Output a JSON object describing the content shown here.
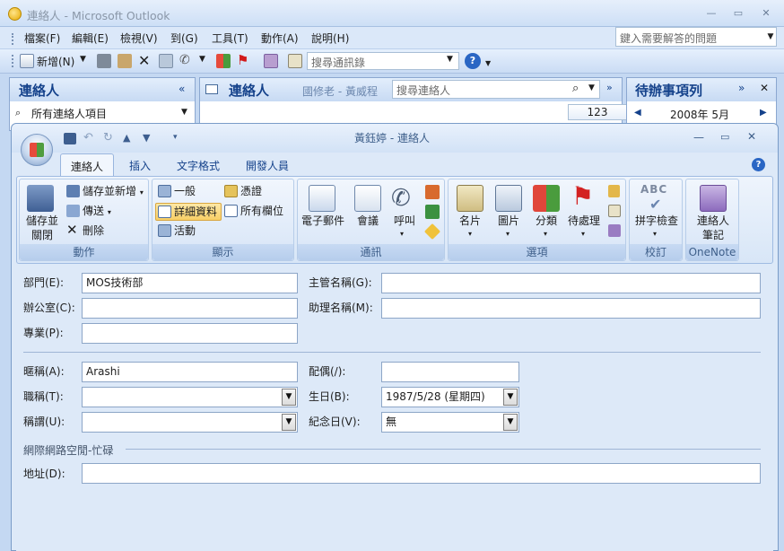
{
  "window": {
    "title": "連絡人 - Microsoft Outlook"
  },
  "menu": [
    "檔案(F)",
    "編輯(E)",
    "檢視(V)",
    "到(G)",
    "工具(T)",
    "動作(A)",
    "說明(H)"
  ],
  "help_box": {
    "placeholder": "鍵入需要解答的問題"
  },
  "toolbar": {
    "new_label": "新增(N)",
    "search_placeholder": "搜尋通訊錄"
  },
  "left_pane": {
    "title": "連絡人",
    "item": "所有連絡人項目"
  },
  "mid_pane": {
    "title": "連絡人",
    "subtitle": "國修老 - 黃威程",
    "search_placeholder": "搜尋連絡人",
    "index_button": "123"
  },
  "right_pane": {
    "title": "待辦事項列",
    "month": "2008年 5月"
  },
  "inspector": {
    "title": "黃鈺婷 - 連絡人",
    "tabs": [
      "連絡人",
      "插入",
      "文字格式",
      "開發人員"
    ],
    "groups": {
      "actions": {
        "label": "動作",
        "save_close": "儲存並\n關閉",
        "save_new": "儲存並新增",
        "send": "傳送",
        "delete": "刪除"
      },
      "show": {
        "label": "顯示",
        "general": "一般",
        "certificates": "憑證",
        "details": "詳細資料",
        "all_fields": "所有欄位",
        "activities": "活動"
      },
      "communicate": {
        "label": "通訊",
        "email": "電子郵件",
        "meeting": "會議",
        "call": "呼叫"
      },
      "options": {
        "label": "選項",
        "business_card": "名片",
        "picture": "圖片",
        "categorize": "分類",
        "follow_up": "待處理"
      },
      "proofing": {
        "label": "校訂",
        "spelling": "拼字檢查"
      },
      "onenote": {
        "label": "OneNote",
        "contact_notes": "連絡人\n筆記"
      }
    }
  },
  "form": {
    "department": {
      "label": "部門(E):",
      "value": "MOS技術部"
    },
    "office": {
      "label": "辦公室(C):",
      "value": ""
    },
    "profession": {
      "label": "專業(P):",
      "value": ""
    },
    "manager": {
      "label": "主管名稱(G):",
      "value": ""
    },
    "assistant": {
      "label": "助理名稱(M):",
      "value": ""
    },
    "nickname": {
      "label": "暱稱(A):",
      "value": "Arashi"
    },
    "title": {
      "label": "職稱(T):",
      "value": ""
    },
    "suffix": {
      "label": "稱謂(U):",
      "value": ""
    },
    "spouse": {
      "label": "配偶(/):",
      "value": ""
    },
    "birthday": {
      "label": "生日(B):",
      "value": "1987/5/28 (星期四)"
    },
    "anniversary": {
      "label": "紀念日(V):",
      "value": "無"
    },
    "internet_section": "網際網路空閒-忙碌",
    "address": {
      "label": "地址(D):",
      "value": ""
    }
  }
}
